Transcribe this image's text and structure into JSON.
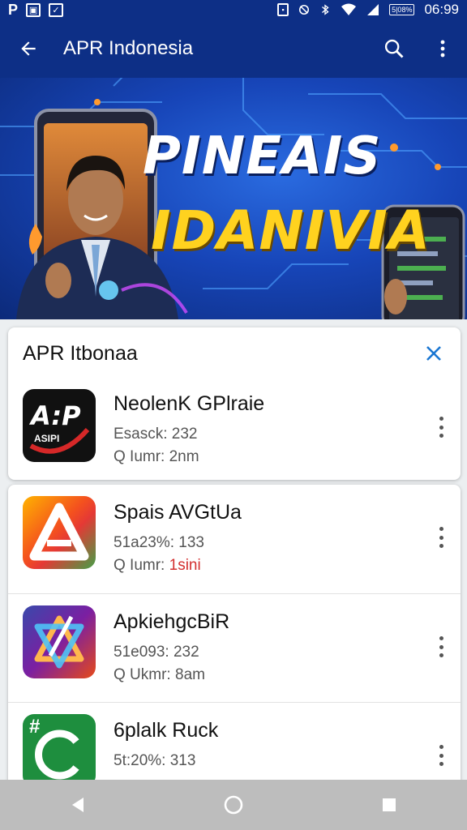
{
  "status_bar": {
    "left_icons": [
      "P",
      "image-icon",
      "check-icon"
    ],
    "battery": "5|08%",
    "time": "06:99"
  },
  "app_bar": {
    "title": "APR Indonesia",
    "icons": [
      "back-arrow-icon",
      "search-icon",
      "more-vert-icon"
    ]
  },
  "banner": {
    "line1": "PINEAIS",
    "line2": "IDANIVIA"
  },
  "featured_card": {
    "heading": "APR Itbonaa",
    "item": {
      "icon_text": "A:P",
      "icon_subtext": "ASIPI",
      "name": "NeolenK GPlraie",
      "meta1": "Esasck: 232",
      "meta2": "Q Iumr: 2nm"
    }
  },
  "list": [
    {
      "name": "Spais AVGtUa",
      "meta1": "51a23%: 133",
      "meta2_label": "Q Iumr: ",
      "meta2_value": "1sini",
      "meta2_red": true,
      "icon": "colorful-a-icon"
    },
    {
      "name": "ApkiehgcBiR",
      "meta1": "51e093: 232",
      "meta2_label": "Q Ukmr: ",
      "meta2_value": "8am",
      "meta2_red": false,
      "icon": "triangle-logo-icon"
    },
    {
      "name": "6plalk Ruck",
      "meta1": "5t:20%: 313",
      "meta2_label": "",
      "meta2_value": "",
      "meta2_red": false,
      "icon_text": "#",
      "icon": "green-c-icon"
    }
  ],
  "colors": {
    "primary": "#0d2f86",
    "banner_yellow": "#ffd21f",
    "accent": "#1976d2",
    "nav_bg": "#bdbdbd"
  }
}
